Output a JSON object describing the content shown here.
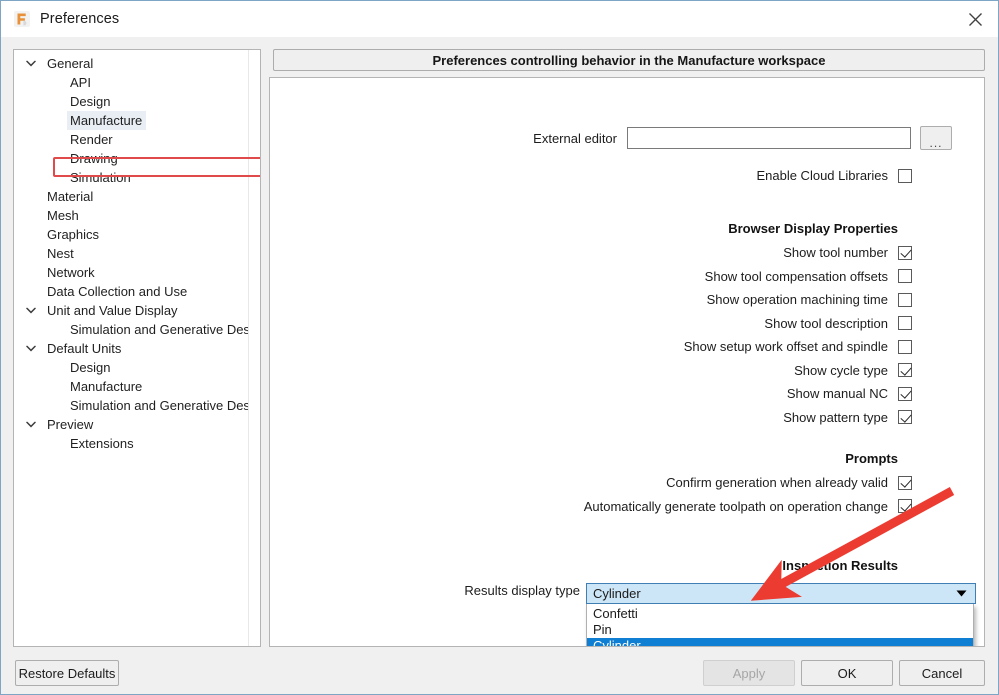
{
  "window": {
    "title": "Preferences",
    "icon": "fusion-f-icon",
    "close_label": "close-icon",
    "accent_orange": "#e8913a",
    "annotation_red": "#e8403a",
    "selection_blue": "#0f7fd4",
    "combo_field_blue": "#cde6f7"
  },
  "sidebar": {
    "items": [
      {
        "label": "General",
        "level": 0,
        "expander": "chevron-down",
        "selected": false
      },
      {
        "label": "API",
        "level": 1,
        "expander": "",
        "selected": false
      },
      {
        "label": "Design",
        "level": 1,
        "expander": "",
        "selected": false
      },
      {
        "label": "Manufacture",
        "level": 1,
        "expander": "",
        "selected": true
      },
      {
        "label": "Render",
        "level": 1,
        "expander": "",
        "selected": false
      },
      {
        "label": "Drawing",
        "level": 1,
        "expander": "",
        "selected": false
      },
      {
        "label": "Simulation",
        "level": 1,
        "expander": "",
        "selected": false
      },
      {
        "label": "Material",
        "level": 0,
        "expander": "",
        "selected": false
      },
      {
        "label": "Mesh",
        "level": 0,
        "expander": "",
        "selected": false
      },
      {
        "label": "Graphics",
        "level": 0,
        "expander": "",
        "selected": false
      },
      {
        "label": "Nest",
        "level": 0,
        "expander": "",
        "selected": false
      },
      {
        "label": "Network",
        "level": 0,
        "expander": "",
        "selected": false
      },
      {
        "label": "Data Collection and Use",
        "level": 0,
        "expander": "",
        "selected": false
      },
      {
        "label": "Unit and Value Display",
        "level": 0,
        "expander": "chevron-down",
        "selected": false
      },
      {
        "label": "Simulation and Generative Design",
        "level": 1,
        "expander": "",
        "selected": false
      },
      {
        "label": "Default Units",
        "level": 0,
        "expander": "chevron-down",
        "selected": false
      },
      {
        "label": "Design",
        "level": 1,
        "expander": "",
        "selected": false
      },
      {
        "label": "Manufacture",
        "level": 1,
        "expander": "",
        "selected": false
      },
      {
        "label": "Simulation and Generative Design",
        "level": 1,
        "expander": "",
        "selected": false
      },
      {
        "label": "Preview",
        "level": 0,
        "expander": "chevron-down",
        "selected": false
      },
      {
        "label": "Extensions",
        "level": 1,
        "expander": "",
        "selected": false
      }
    ]
  },
  "main": {
    "header": "Preferences controlling behavior in the Manufacture workspace",
    "external_editor": {
      "label": "External editor",
      "value": "",
      "placeholder": "",
      "browse_label": "..."
    },
    "enable_cloud_libraries": {
      "label": "Enable Cloud Libraries",
      "checked": false
    },
    "browser_display": {
      "title": "Browser Display Properties",
      "rows": [
        {
          "label": "Show tool number",
          "checked": true
        },
        {
          "label": "Show tool compensation offsets",
          "checked": false
        },
        {
          "label": "Show operation machining time",
          "checked": false
        },
        {
          "label": "Show tool description",
          "checked": false
        },
        {
          "label": "Show setup work offset and spindle",
          "checked": false
        },
        {
          "label": "Show cycle type",
          "checked": true
        },
        {
          "label": "Show manual NC",
          "checked": true
        },
        {
          "label": "Show pattern type",
          "checked": true
        }
      ]
    },
    "prompts": {
      "title": "Prompts",
      "rows": [
        {
          "label": "Confirm generation when already valid",
          "checked": true
        },
        {
          "label": "Automatically generate toolpath on operation change",
          "checked": true
        }
      ]
    },
    "inspection_results": {
      "title": "Inspection Results",
      "results_display_type": {
        "label": "Results display type",
        "value": "Cylinder",
        "expanded": true,
        "options": [
          {
            "label": "Confetti",
            "selected": false
          },
          {
            "label": "Pin",
            "selected": false
          },
          {
            "label": "Cylinder",
            "selected": true
          }
        ]
      }
    }
  },
  "footer": {
    "restore_defaults": "Restore Defaults",
    "apply": "Apply",
    "apply_enabled": false,
    "ok": "OK",
    "cancel": "Cancel"
  }
}
